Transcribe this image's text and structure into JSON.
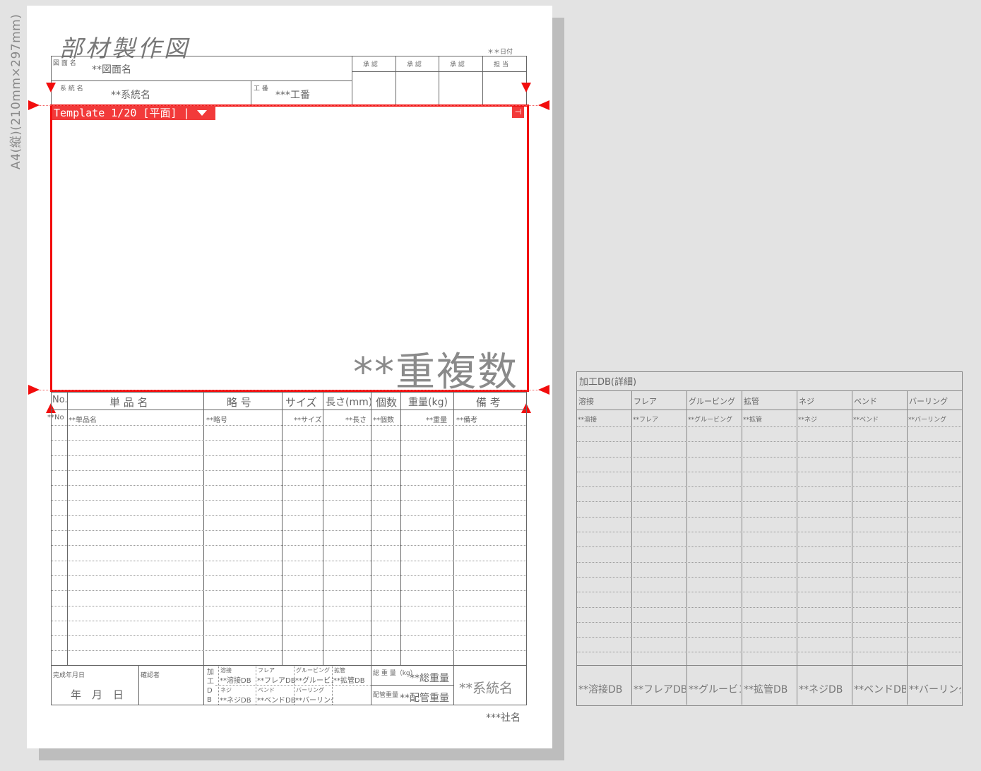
{
  "page_size_label": "A4(縦)(210mm×297mm)",
  "title": "部材製作図",
  "header": {
    "date_label": "＊＊日付",
    "drawing_name_label": "図 面 名",
    "drawing_name": "**図面名",
    "system_name_label": "系 統 名",
    "system_name": "**系統名",
    "work_no_label": "工 番",
    "work_no": "***工番",
    "approval_labels": [
      "承 認",
      "承 認",
      "承 認",
      "担 当"
    ]
  },
  "template": {
    "tab_label": "Template 1/20 [平面] |",
    "duplicate_count": "**重複数"
  },
  "parts_table": {
    "columns": [
      "No.",
      "単 品 名",
      "略 号",
      "サイズ",
      "長さ(mm)",
      "個数",
      "重量(kg)",
      "備 考"
    ],
    "first_row": [
      "**No",
      "**単品名",
      "**略号",
      "**サイズ",
      "**長さ",
      "**個数",
      "**重量",
      "**備考"
    ]
  },
  "footer": {
    "completion_date_label": "完成年月日",
    "date_units": "年　月　日",
    "confirmer_label": "確認者",
    "processing_label": "加工DB",
    "processing_items": [
      {
        "label": "溶接",
        "value": "**溶接DB"
      },
      {
        "label": "フレア",
        "value": "**フレアDB"
      },
      {
        "label": "グルービング",
        "value": "**グルービングDB"
      },
      {
        "label": "拡管",
        "value": "**拡管DB"
      },
      {
        "label": "ネジ",
        "value": "**ネジDB"
      },
      {
        "label": "ベンド",
        "value": "**ベンドDB"
      },
      {
        "label": "バーリング",
        "value": "**バーリングDB"
      }
    ],
    "total_weight_label": "総 重 量（kg）",
    "total_weight": "**総重量",
    "pipe_weight_label": "配管重量",
    "pipe_weight": "**配管重量",
    "system_name": "**系統名",
    "company": "***社名"
  },
  "db_panel": {
    "title": "加工DB(詳細)",
    "columns": [
      "溶接",
      "フレア",
      "グルービング",
      "拡管",
      "ネジ",
      "ベンド",
      "バーリング"
    ],
    "row_values": [
      "**溶接",
      "**フレア",
      "**グルービング",
      "**拡管",
      "**ネジ",
      "**ベンド",
      "**バーリング"
    ],
    "footer_values": [
      "**溶接DB",
      "**フレアDB",
      "**グルービング",
      "**拡管DB",
      "**ネジDB",
      "**ベンドDB",
      "**バーリングDB"
    ]
  },
  "colors": {
    "accent_red": "#f20d0d",
    "background": "#e3e3e3",
    "paper": "#ffffff"
  }
}
